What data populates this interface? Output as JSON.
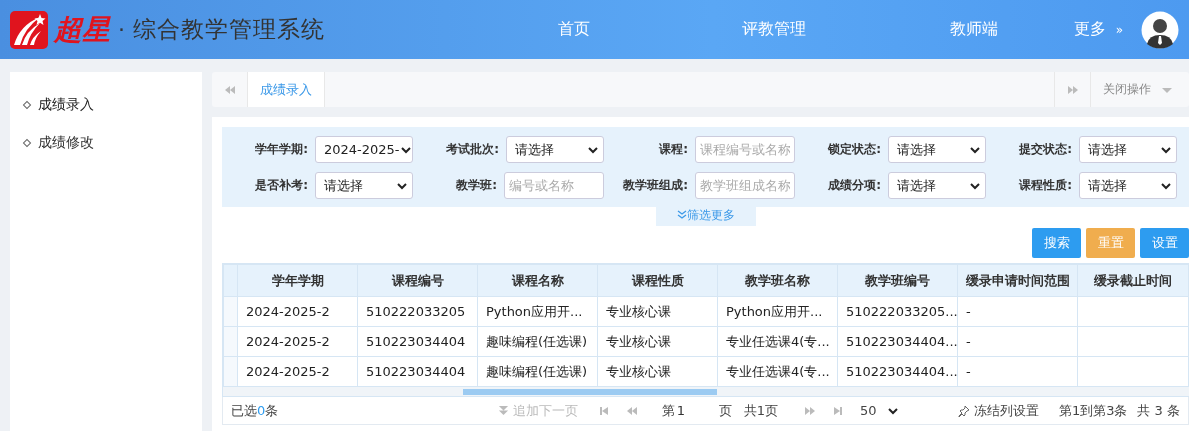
{
  "header": {
    "logo_text": "超星",
    "separator": "·",
    "system_title": "综合教学管理系统",
    "nav": [
      {
        "label": "首页",
        "selected": false
      },
      {
        "label": "评教管理",
        "selected": false
      },
      {
        "label": "教师端",
        "selected": false
      }
    ],
    "more": {
      "label": "更多",
      "arrow": "»"
    }
  },
  "sidebar": {
    "items": [
      {
        "label": "成绩录入",
        "selected": true
      },
      {
        "label": "成绩修改",
        "selected": false
      }
    ]
  },
  "tabbar": {
    "tabs": [
      {
        "label": "成绩录入",
        "selected": true
      }
    ],
    "close_menu": "关闭操作"
  },
  "filters": [
    {
      "label": "学年学期:",
      "kind": "select",
      "value": "2024-2025-"
    },
    {
      "label": "考试批次:",
      "kind": "select",
      "value": "请选择"
    },
    {
      "label": "课程:",
      "kind": "input",
      "placeholder": "课程编号或名称"
    },
    {
      "label": "锁定状态:",
      "kind": "select",
      "value": "请选择"
    },
    {
      "label": "提交状态:",
      "kind": "select",
      "value": "请选择"
    },
    {
      "label": "是否补考:",
      "kind": "select",
      "value": "请选择"
    },
    {
      "label": "教学班:",
      "kind": "input",
      "placeholder": "编号或名称"
    },
    {
      "label": "教学班组成:",
      "kind": "input",
      "placeholder": "教学班组成名称"
    },
    {
      "label": "成绩分项:",
      "kind": "select",
      "value": "请选择"
    },
    {
      "label": "课程性质:",
      "kind": "select",
      "value": "请选择"
    }
  ],
  "more_filters": "筛选更多",
  "buttons": [
    {
      "label": "搜索",
      "kind": "primary"
    },
    {
      "label": "重置",
      "kind": "warning"
    },
    {
      "label": "设置",
      "kind": "primary"
    }
  ],
  "table": {
    "columns": [
      "学年学期",
      "课程编号",
      "课程名称",
      "课程性质",
      "教学班名称",
      "教学班编号",
      "缓录申请时间范围",
      "缓录截止时间"
    ],
    "rows": [
      [
        "2024-2025-2",
        "510222033205",
        "Python应用开...",
        "专业核心课",
        "Python应用开...",
        "510222033205...",
        "-",
        ""
      ],
      [
        "2024-2025-2",
        "510223034404",
        "趣味编程(任选课)",
        "专业核心课",
        "专业任选课4(专...",
        "510223034404...",
        "-",
        ""
      ],
      [
        "2024-2025-2",
        "510223034404",
        "趣味编程(任选课)",
        "专业核心课",
        "专业任选课4(专...",
        "510223034404...",
        "-",
        ""
      ]
    ]
  },
  "footer": {
    "selected_prefix": "已选",
    "selected_count": "0",
    "selected_suffix": "条",
    "append_next": "追加下一页",
    "page_prefix": "第",
    "page_value": "1",
    "page_suffix": "页",
    "total_pages": "共1页",
    "page_size": "50",
    "freeze_columns": "冻结列设置",
    "range": "第1到第3条",
    "total": "共 3 条"
  }
}
